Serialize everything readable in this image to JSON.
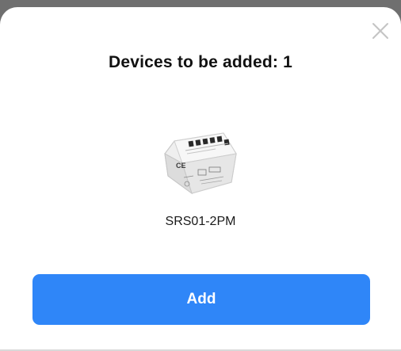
{
  "dialog": {
    "title": "Devices to be added: 1",
    "close_icon": "close-icon",
    "device": {
      "name": "SRS01-2PM",
      "image_icon": "smart-relay-module-icon"
    },
    "add_label": "Add"
  },
  "colors": {
    "backdrop": "#6f6f6f",
    "sheet": "#ffffff",
    "accent": "#2f86f8",
    "title_text": "#111111",
    "close_icon": "#c4c4c4"
  }
}
